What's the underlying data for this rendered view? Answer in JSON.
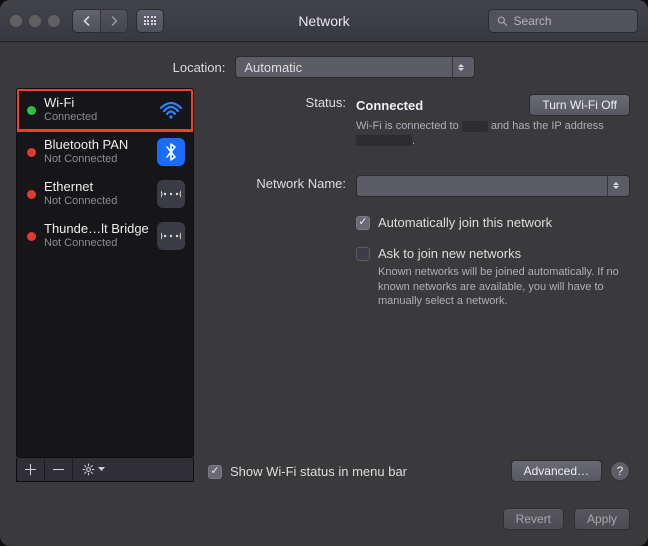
{
  "window": {
    "title": "Network"
  },
  "toolbar": {
    "search_placeholder": "Search"
  },
  "location": {
    "label": "Location:",
    "value": "Automatic"
  },
  "sidebar": {
    "items": [
      {
        "name": "Wi-Fi",
        "sub": "Connected",
        "dot": "#2fbf48",
        "selected": true,
        "icon": "wifi"
      },
      {
        "name": "Bluetooth PAN",
        "sub": "Not Connected",
        "dot": "#e03a33",
        "selected": false,
        "icon": "bluetooth"
      },
      {
        "name": "Ethernet",
        "sub": "Not Connected",
        "dot": "#e03a33",
        "selected": false,
        "icon": "ethernet"
      },
      {
        "name": "Thunde…lt Bridge",
        "sub": "Not Connected",
        "dot": "#e03a33",
        "selected": false,
        "icon": "thunderbolt"
      }
    ]
  },
  "detail": {
    "status_label": "Status:",
    "status_value": "Connected",
    "toggle_label": "Turn Wi-Fi Off",
    "status_hint_pre": "Wi-Fi is connected to ",
    "status_hint_mid": " and has the IP address ",
    "status_hint_suf": ".",
    "netname_label": "Network Name:",
    "netname_value": "",
    "auto_join": "Automatically join this network",
    "ask_join": "Ask to join new networks",
    "ask_hint": "Known networks will be joined automatically. If no known networks are available, you will have to manually select a network.",
    "show_status": "Show Wi-Fi status in menu bar",
    "advanced": "Advanced…"
  },
  "actions": {
    "revert": "Revert",
    "apply": "Apply"
  },
  "colors": {
    "traffic_close": "#615f60",
    "traffic_min": "#615f60",
    "traffic_max": "#615f60"
  }
}
